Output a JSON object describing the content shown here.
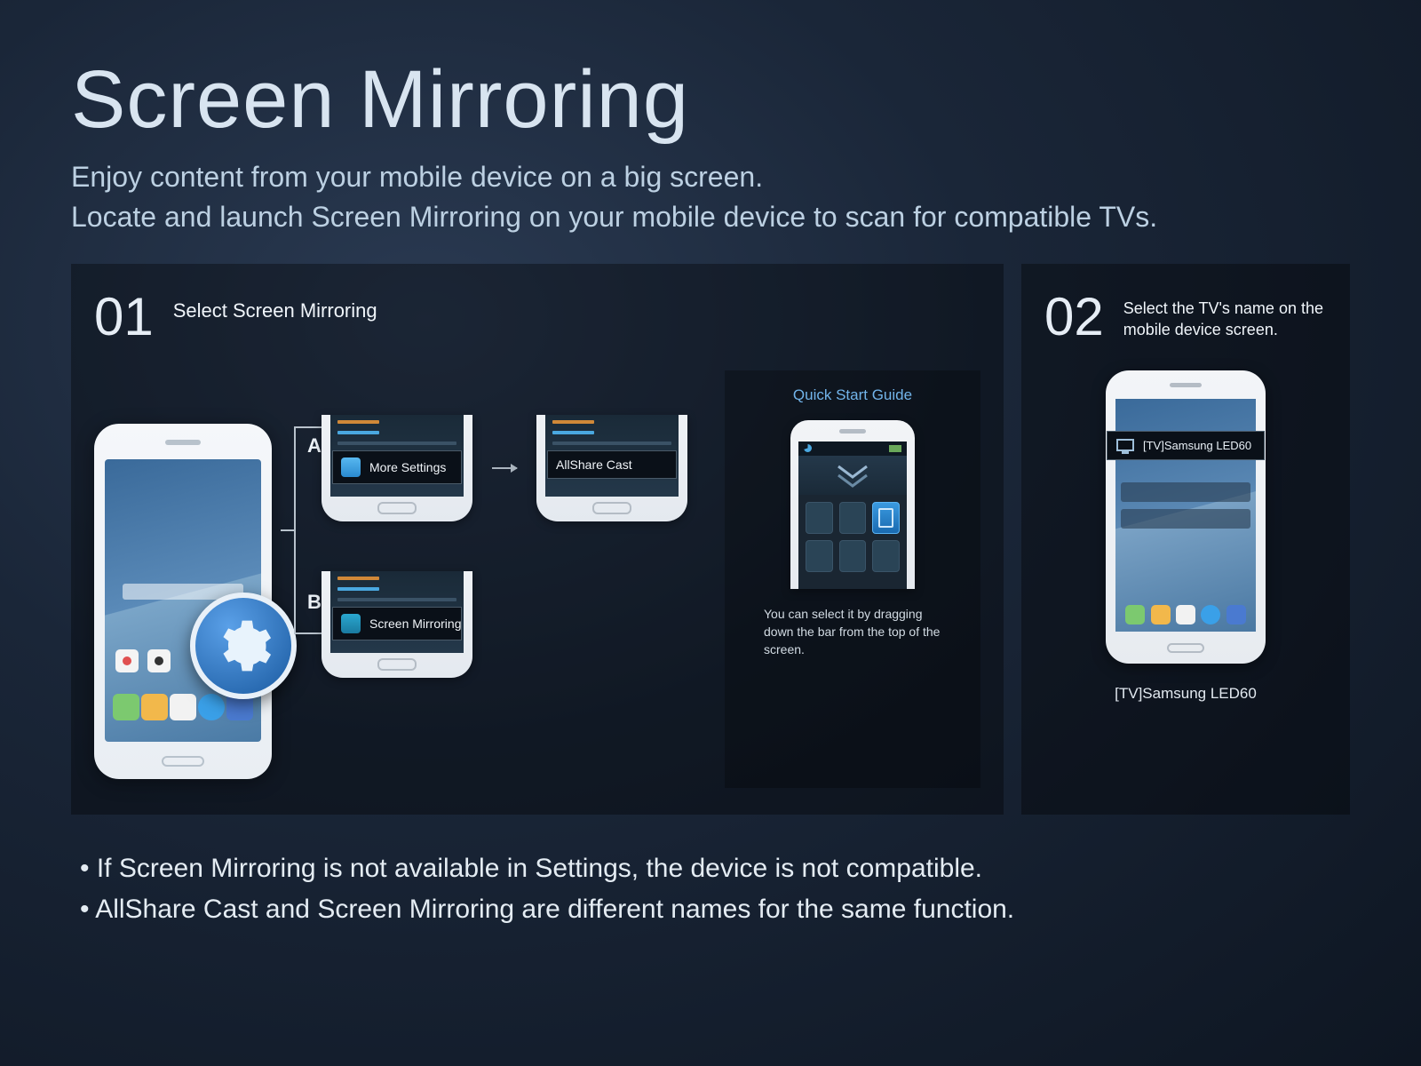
{
  "header": {
    "title": "Screen Mirroring",
    "subtitle1": "Enjoy content from your mobile device on a big screen.",
    "subtitle2": "Locate and launch Screen Mirroring on your mobile device to scan for compatible TVs."
  },
  "step01": {
    "number": "01",
    "title": "Select Screen Mirroring",
    "branchA": {
      "label": "A",
      "option1": "More Settings",
      "option2": "AllShare Cast"
    },
    "branchB": {
      "label": "B",
      "option1": "Screen Mirroring"
    },
    "quickStart": {
      "title": "Quick Start Guide",
      "text": "You can select it by dragging down the bar from the top of the screen."
    }
  },
  "step02": {
    "number": "02",
    "title": "Select the TV's name on the mobile device screen.",
    "castRow": "[TV]Samsung LED60",
    "caption": "[TV]Samsung LED60"
  },
  "footer": {
    "line1": "If Screen Mirroring is not available in Settings, the device is not compatible.",
    "line2": "AllShare Cast and Screen Mirroring are different names for the same function."
  }
}
